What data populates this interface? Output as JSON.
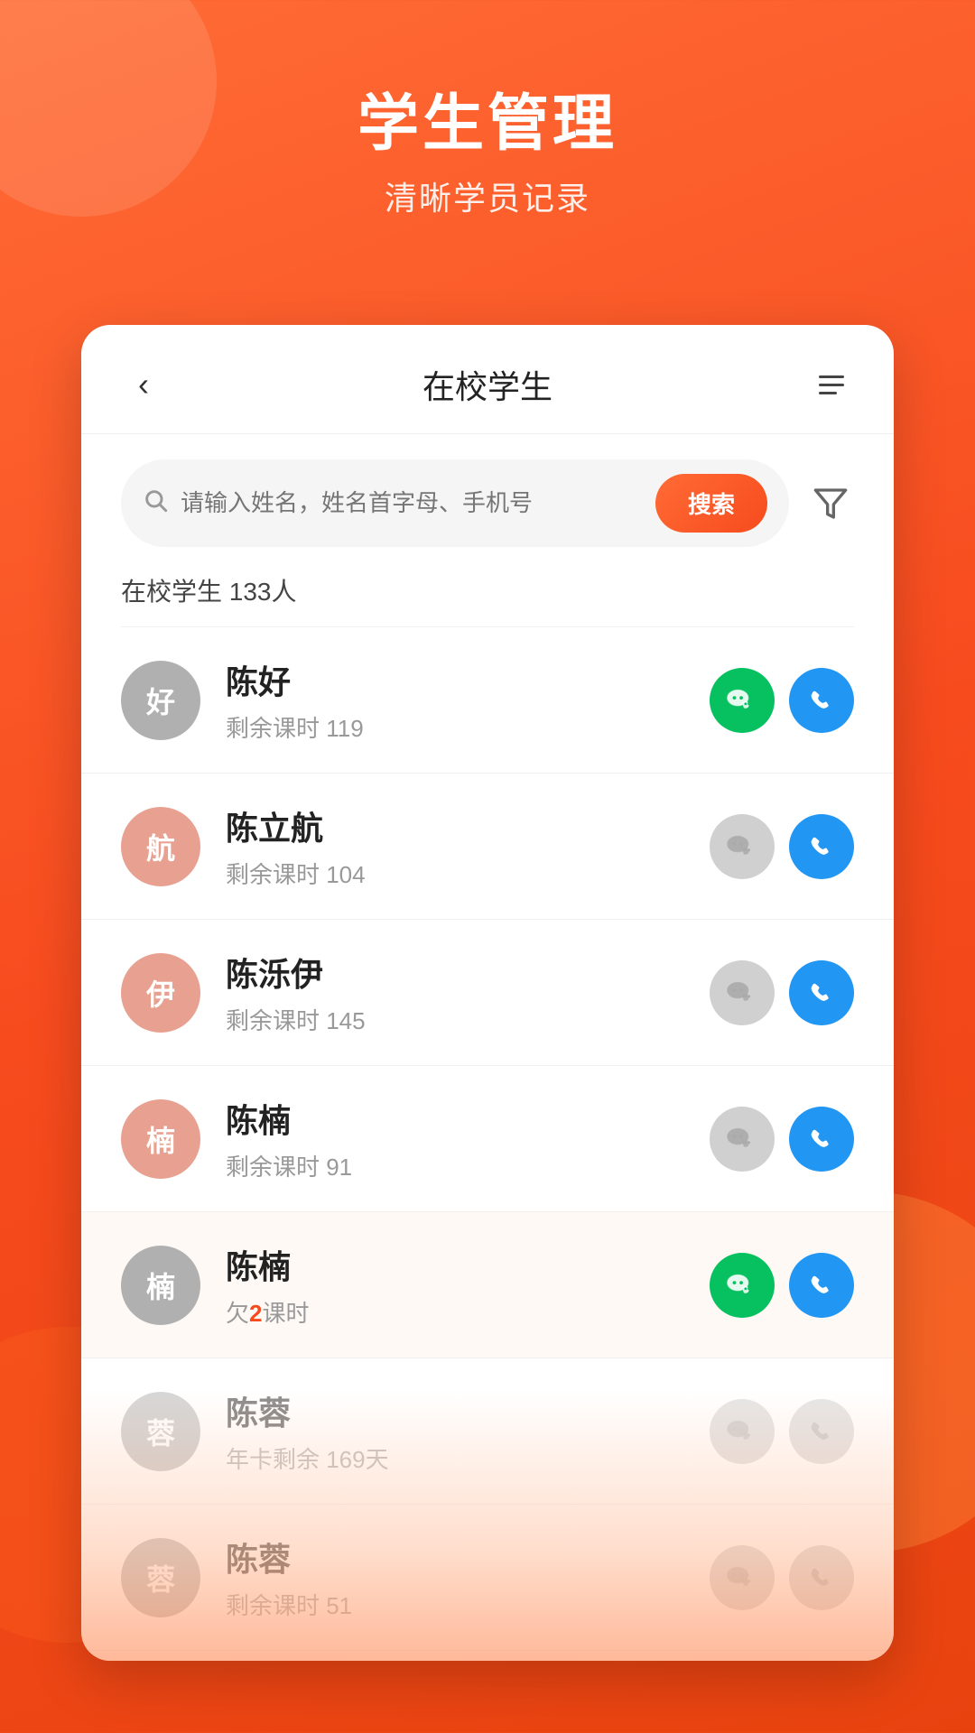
{
  "header": {
    "title": "学生管理",
    "subtitle": "清晰学员记录"
  },
  "card": {
    "back_label": "‹",
    "page_title": "在校学生",
    "search_placeholder": "请输入姓名，姓名首字母、手机号",
    "search_button_label": "搜索",
    "student_count_label": "在校学生 133人",
    "students": [
      {
        "id": 1,
        "avatar_char": "好",
        "avatar_style": "gray",
        "name": "陈好",
        "detail": "剩余课时 119",
        "detail_type": "normal",
        "wechat": "active",
        "phone": "active",
        "highlighted": false,
        "faded": false
      },
      {
        "id": 2,
        "avatar_char": "航",
        "avatar_style": "peach",
        "name": "陈立航",
        "detail": "剩余课时 104",
        "detail_type": "normal",
        "wechat": "inactive",
        "phone": "active",
        "highlighted": false,
        "faded": false
      },
      {
        "id": 3,
        "avatar_char": "伊",
        "avatar_style": "peach",
        "name": "陈泺伊",
        "detail": "剩余课时 145",
        "detail_type": "normal",
        "wechat": "inactive",
        "phone": "active",
        "highlighted": false,
        "faded": false
      },
      {
        "id": 4,
        "avatar_char": "楠",
        "avatar_style": "peach",
        "name": "陈楠",
        "detail": "剩余课时 91",
        "detail_type": "normal",
        "wechat": "inactive",
        "phone": "active",
        "highlighted": false,
        "faded": false
      },
      {
        "id": 5,
        "avatar_char": "楠",
        "avatar_style": "gray",
        "name": "陈楠",
        "detail_prefix": "欠",
        "detail_highlight": "2",
        "detail_suffix": "课时",
        "detail_type": "highlight",
        "wechat": "active",
        "phone": "active",
        "highlighted": true,
        "faded": false
      },
      {
        "id": 6,
        "avatar_char": "蓉",
        "avatar_style": "gray",
        "name": "陈蓉",
        "detail": "年卡剩余 169天",
        "detail_type": "normal",
        "wechat": "inactive",
        "phone": "inactive",
        "highlighted": false,
        "faded": true
      },
      {
        "id": 7,
        "avatar_char": "蓉",
        "avatar_style": "gray",
        "name": "陈蓉",
        "detail": "剩余课时 51",
        "detail_type": "normal",
        "wechat": "inactive",
        "phone": "inactive",
        "highlighted": false,
        "faded": true
      }
    ]
  }
}
